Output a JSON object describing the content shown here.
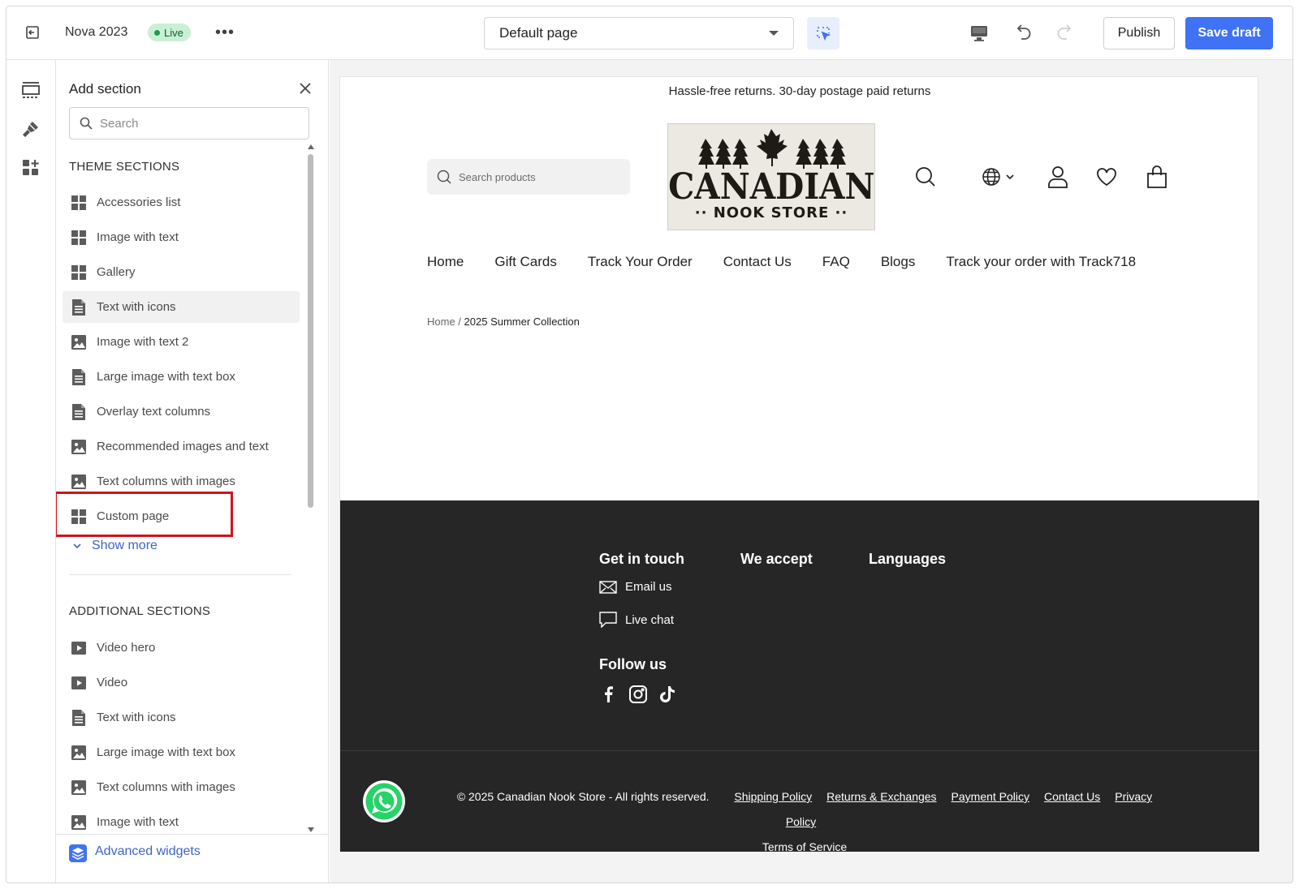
{
  "topbar": {
    "store_name": "Nova 2023",
    "status": "Live",
    "more": "•••",
    "page_select": "Default page",
    "publish_label": "Publish",
    "save_label": "Save draft"
  },
  "panel": {
    "title": "Add section",
    "search_placeholder": "Search",
    "theme_label": "THEME SECTIONS",
    "theme_items": [
      {
        "label": "Accessories list",
        "icon": "grid-icon"
      },
      {
        "label": "Image with text",
        "icon": "grid-icon"
      },
      {
        "label": "Gallery",
        "icon": "grid-icon"
      },
      {
        "label": "Text with icons",
        "icon": "document-icon"
      },
      {
        "label": "Image with text 2",
        "icon": "image-icon"
      },
      {
        "label": "Large image with text box",
        "icon": "document-icon"
      },
      {
        "label": "Overlay text columns",
        "icon": "document-icon"
      },
      {
        "label": "Recommended images and text",
        "icon": "image-icon"
      },
      {
        "label": "Text columns with images",
        "icon": "image-icon"
      },
      {
        "label": "Custom page",
        "icon": "grid-icon"
      }
    ],
    "show_more": "Show more",
    "additional_label": "ADDITIONAL SECTIONS",
    "additional_items": [
      {
        "label": "Video hero",
        "icon": "video-icon"
      },
      {
        "label": "Video",
        "icon": "video-icon"
      },
      {
        "label": "Text with icons",
        "icon": "document-icon"
      },
      {
        "label": "Large image with text box",
        "icon": "image-icon"
      },
      {
        "label": "Text columns with images",
        "icon": "image-icon"
      },
      {
        "label": "Image with text",
        "icon": "image-icon"
      }
    ],
    "advanced": "Advanced widgets"
  },
  "store": {
    "announcement": "Hassle-free returns. 30-day postage paid returns",
    "search_placeholder": "Search products",
    "logo_title": "CANADIAN",
    "logo_sub": "·· NOOK STORE ··",
    "nav": [
      "Home",
      "Gift Cards",
      "Track Your Order",
      "Contact Us",
      "FAQ",
      "Blogs",
      "Track your order with Track718"
    ],
    "breadcrumb_home": "Home",
    "breadcrumb_sep": " / ",
    "breadcrumb_current": "2025 Summer Collection"
  },
  "footer": {
    "get_in_touch": "Get in touch",
    "we_accept": "We accept",
    "languages": "Languages",
    "email": "Email us",
    "chat": "Live chat",
    "follow": "Follow us",
    "copyright": "© 2025 Canadian Nook Store - All rights reserved.",
    "links": [
      "Shipping Policy",
      "Returns & Exchanges",
      "Payment Policy",
      "Contact Us",
      "Privacy Policy",
      "Terms of Service"
    ]
  },
  "colors": {
    "accent": "#3f72f5",
    "live_badge": "#c9f0d4",
    "highlight": "#d3121c",
    "footer_bg": "#262626"
  }
}
